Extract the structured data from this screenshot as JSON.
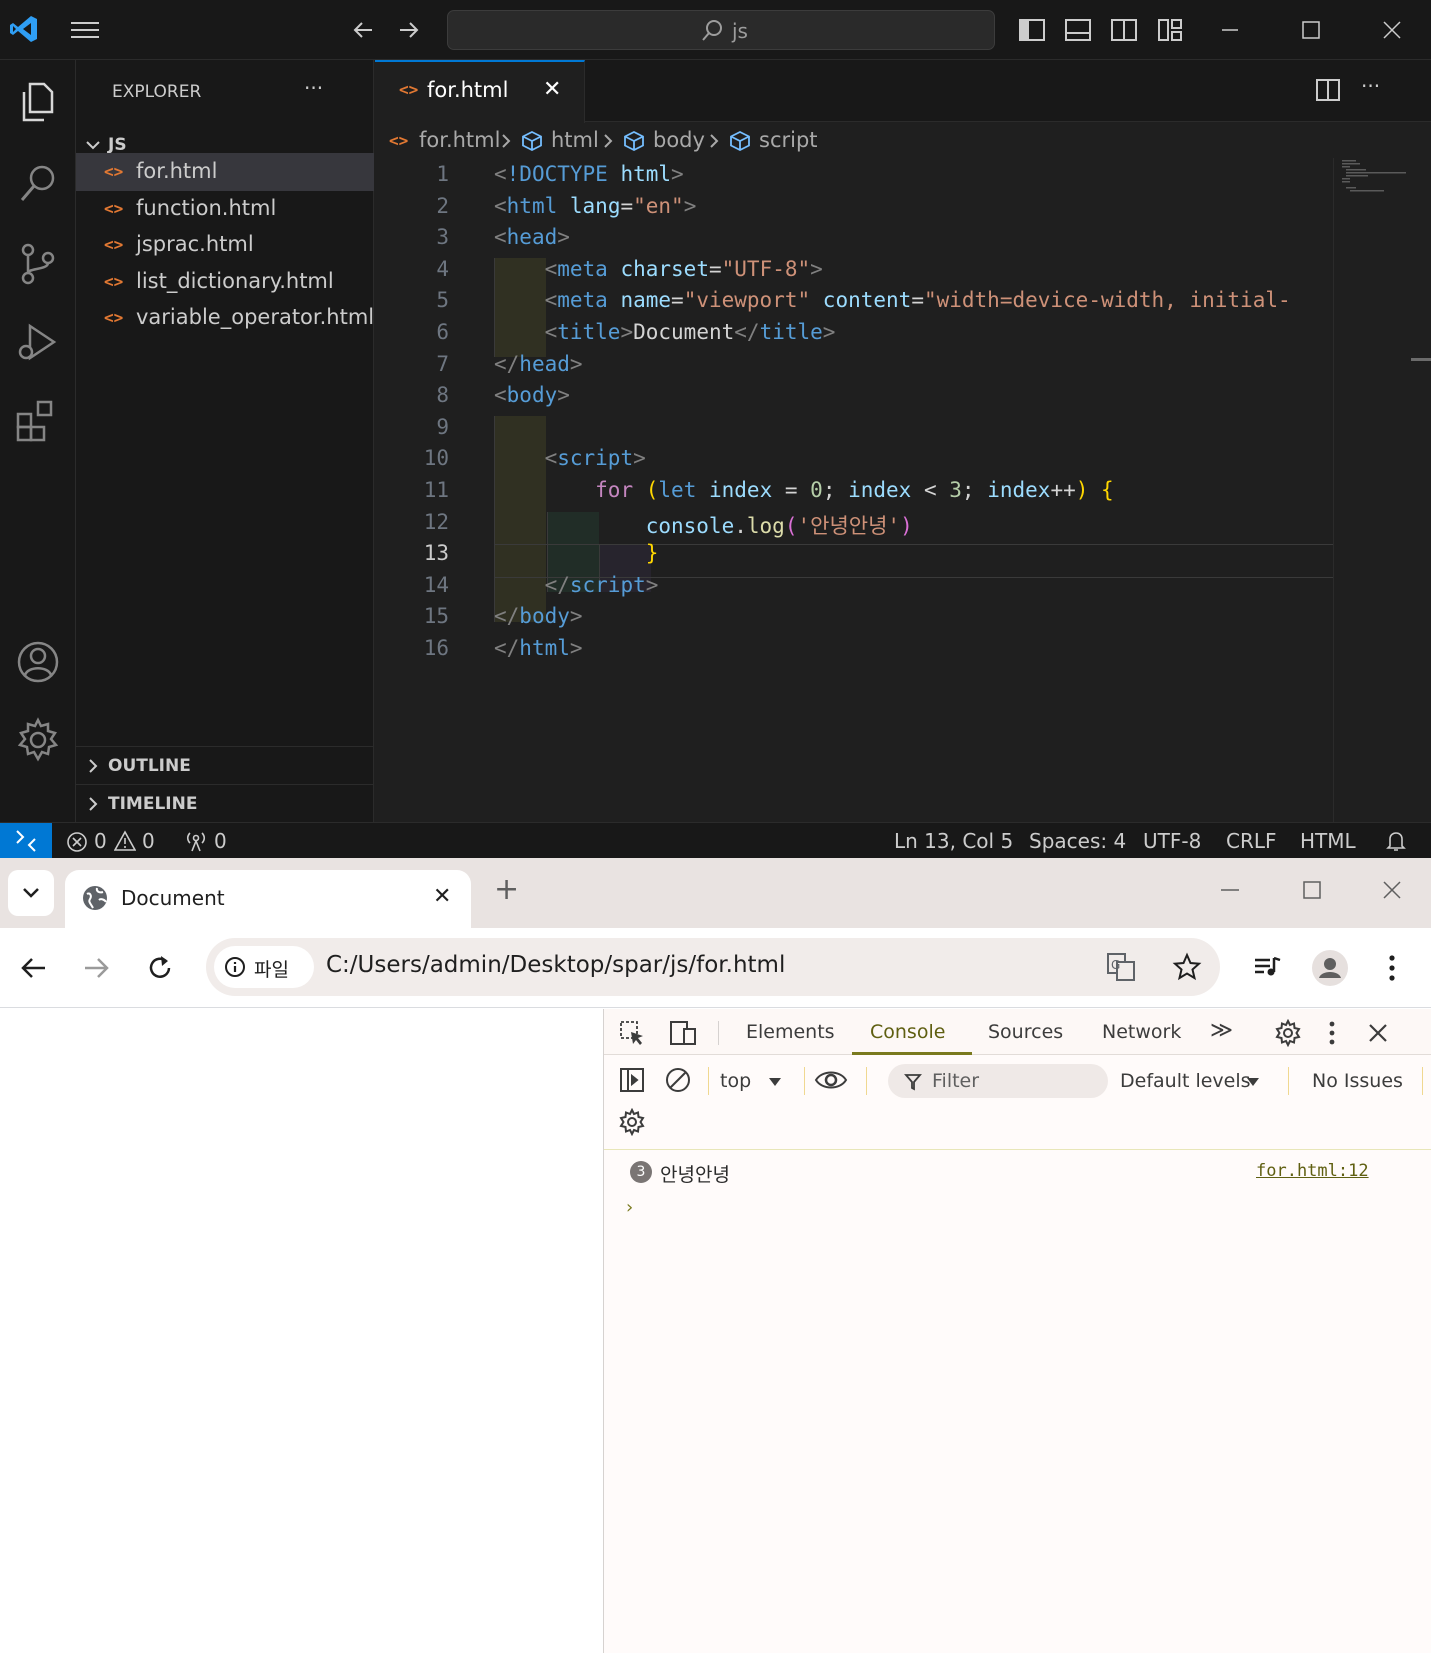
{
  "vscode": {
    "search_text": "js",
    "sidebar": {
      "title": "EXPLORER",
      "more": "···",
      "folder": "JS",
      "files": [
        {
          "name": "for.html",
          "selected": true
        },
        {
          "name": "function.html",
          "selected": false
        },
        {
          "name": "jsprac.html",
          "selected": false
        },
        {
          "name": "list_dictionary.html",
          "selected": false
        },
        {
          "name": "variable_operator.html",
          "selected": false
        }
      ],
      "outline": "OUTLINE",
      "timeline": "TIMELINE"
    },
    "file_icon_glyph": "<>",
    "tab": {
      "label": "for.html",
      "close": "✕"
    },
    "breadcrumb": [
      "for.html",
      "html",
      "body",
      "script"
    ],
    "line_numbers": [
      "1",
      "2",
      "3",
      "4",
      "5",
      "6",
      "7",
      "8",
      "9",
      "10",
      "11",
      "12",
      "13",
      "14",
      "15",
      "16"
    ],
    "current_line": 13,
    "code": [
      [
        [
          "t-br",
          "<"
        ],
        [
          "t-tag",
          "!DOCTYPE"
        ],
        [
          "t-txt",
          " "
        ],
        [
          "t-attr",
          "html"
        ],
        [
          "t-br",
          ">"
        ]
      ],
      [
        [
          "t-br",
          "<"
        ],
        [
          "t-tag",
          "html"
        ],
        [
          "t-txt",
          " "
        ],
        [
          "t-attr",
          "lang"
        ],
        [
          "t-txt",
          "="
        ],
        [
          "t-str",
          "\"en\""
        ],
        [
          "t-br",
          ">"
        ]
      ],
      [
        [
          "t-br",
          "<"
        ],
        [
          "t-tag",
          "head"
        ],
        [
          "t-br",
          ">"
        ]
      ],
      [
        [
          "t-txt",
          "    "
        ],
        [
          "t-br",
          "<"
        ],
        [
          "t-tag",
          "meta"
        ],
        [
          "t-txt",
          " "
        ],
        [
          "t-attr",
          "charset"
        ],
        [
          "t-txt",
          "="
        ],
        [
          "t-str",
          "\"UTF-8\""
        ],
        [
          "t-br",
          ">"
        ]
      ],
      [
        [
          "t-txt",
          "    "
        ],
        [
          "t-br",
          "<"
        ],
        [
          "t-tag",
          "meta"
        ],
        [
          "t-txt",
          " "
        ],
        [
          "t-attr",
          "name"
        ],
        [
          "t-txt",
          "="
        ],
        [
          "t-str",
          "\"viewport\""
        ],
        [
          "t-txt",
          " "
        ],
        [
          "t-attr",
          "content"
        ],
        [
          "t-txt",
          "="
        ],
        [
          "t-str",
          "\"width=device-width, initial-"
        ]
      ],
      [
        [
          "t-txt",
          "    "
        ],
        [
          "t-br",
          "<"
        ],
        [
          "t-tag",
          "title"
        ],
        [
          "t-br",
          ">"
        ],
        [
          "t-txt",
          "Document"
        ],
        [
          "t-br",
          "</"
        ],
        [
          "t-tag",
          "title"
        ],
        [
          "t-br",
          ">"
        ]
      ],
      [
        [
          "t-br",
          "</"
        ],
        [
          "t-tag",
          "head"
        ],
        [
          "t-br",
          ">"
        ]
      ],
      [
        [
          "t-br",
          "<"
        ],
        [
          "t-tag",
          "body"
        ],
        [
          "t-br",
          ">"
        ]
      ],
      [
        [
          "t-txt",
          ""
        ]
      ],
      [
        [
          "t-txt",
          "    "
        ],
        [
          "t-br",
          "<"
        ],
        [
          "t-tag",
          "script"
        ],
        [
          "t-br",
          ">"
        ]
      ],
      [
        [
          "t-txt",
          "        "
        ],
        [
          "t-kw",
          "for"
        ],
        [
          "t-txt",
          " "
        ],
        [
          "t-p1",
          "("
        ],
        [
          "t-key",
          "let"
        ],
        [
          "t-txt",
          " "
        ],
        [
          "t-var",
          "index"
        ],
        [
          "t-txt",
          " = "
        ],
        [
          "t-num",
          "0"
        ],
        [
          "t-txt",
          "; "
        ],
        [
          "t-var",
          "index"
        ],
        [
          "t-txt",
          " < "
        ],
        [
          "t-num",
          "3"
        ],
        [
          "t-txt",
          "; "
        ],
        [
          "t-var",
          "index"
        ],
        [
          "t-txt",
          "++"
        ],
        [
          "t-p1",
          ")"
        ],
        [
          "t-txt",
          " "
        ],
        [
          "t-p1",
          "{"
        ]
      ],
      [
        [
          "t-txt",
          "            "
        ],
        [
          "t-var",
          "console"
        ],
        [
          "t-txt",
          "."
        ],
        [
          "t-fn",
          "log"
        ],
        [
          "t-p2",
          "("
        ],
        [
          "t-str",
          "'안녕안녕'"
        ],
        [
          "t-p2",
          ")"
        ]
      ],
      [
        [
          "t-txt",
          "            "
        ],
        [
          "t-p1",
          "}"
        ]
      ],
      [
        [
          "t-txt",
          "    "
        ],
        [
          "t-br",
          "</"
        ],
        [
          "t-tag",
          "script"
        ],
        [
          "t-br",
          ">"
        ]
      ],
      [
        [
          "t-br",
          "</"
        ],
        [
          "t-tag",
          "body"
        ],
        [
          "t-br",
          ">"
        ]
      ],
      [
        [
          "t-br",
          "</"
        ],
        [
          "t-tag",
          "html"
        ],
        [
          "t-br",
          ">"
        ]
      ]
    ],
    "status": {
      "errors": "0",
      "warnings": "0",
      "ports": "0",
      "position": "Ln 13, Col 5",
      "spaces": "Spaces: 4",
      "encoding": "UTF-8",
      "eol": "CRLF",
      "language": "HTML"
    },
    "colors": {
      "accent": "#0078d4",
      "bg": "#1f1f1f",
      "chrome": "#181818"
    }
  },
  "chrome": {
    "tab_title": "Document",
    "tab_close": "✕",
    "new_tab": "+",
    "chip_label": "파일",
    "url": "C:/Users/admin/Desktop/spar/js/for.html",
    "devtools": {
      "tabs": [
        "Elements",
        "Console",
        "Sources",
        "Network"
      ],
      "active_tab": "Console",
      "more_tabs": "≫",
      "context": "top",
      "filter_placeholder": "Filter",
      "levels": "Default levels",
      "issues": "No Issues",
      "log": {
        "count": "3",
        "message": "안녕안녕",
        "source": "for.html:12"
      },
      "prompt": "›"
    }
  }
}
